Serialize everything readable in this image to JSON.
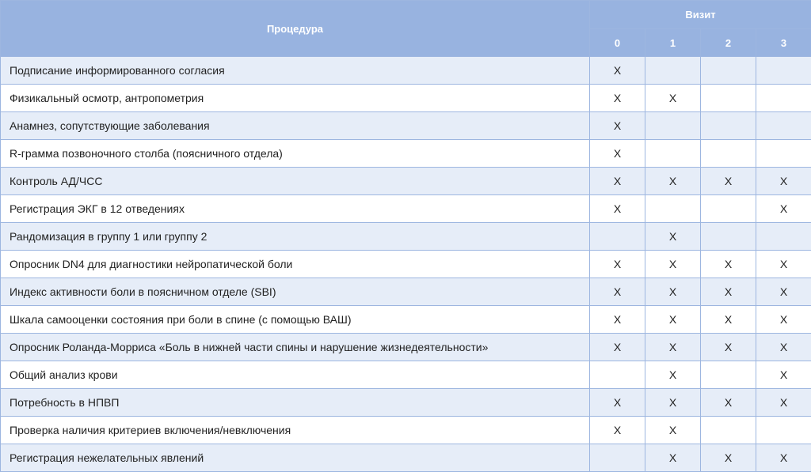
{
  "header": {
    "procedure_label": "Процедура",
    "visit_label": "Визит",
    "visits": [
      "0",
      "1",
      "2",
      "3"
    ]
  },
  "rows": [
    {
      "procedure": "Подписание информированного согласия",
      "marks": [
        "X",
        "",
        "",
        ""
      ]
    },
    {
      "procedure": "Физикальный осмотр, антропометрия",
      "marks": [
        "X",
        "X",
        "",
        ""
      ]
    },
    {
      "procedure": "Анамнез, сопутствующие заболевания",
      "marks": [
        "X",
        "",
        "",
        ""
      ]
    },
    {
      "procedure": "R-грамма позвоночного столба (поясничного отдела)",
      "marks": [
        "X",
        "",
        "",
        ""
      ]
    },
    {
      "procedure": "Контроль АД/ЧСС",
      "marks": [
        "X",
        "X",
        "X",
        "X"
      ]
    },
    {
      "procedure": "Регистрация ЭКГ в 12 отведениях",
      "marks": [
        "X",
        "",
        "",
        "X"
      ]
    },
    {
      "procedure": "Рандомизация в группу 1 или группу 2",
      "marks": [
        "",
        "X",
        "",
        ""
      ]
    },
    {
      "procedure": "Опросник DN4 для диагностики нейропатической боли",
      "marks": [
        "X",
        "X",
        "X",
        "X"
      ]
    },
    {
      "procedure": "Индекс активности боли в поясничном отделе (SBI)",
      "marks": [
        "X",
        "X",
        "X",
        "X"
      ]
    },
    {
      "procedure": "Шкала самооценки состояния при боли в спине (с помощью ВАШ)",
      "marks": [
        "X",
        "X",
        "X",
        "X"
      ]
    },
    {
      "procedure": "Опросник Роланда-Морриса «Боль в нижней части спины и нарушение жизнедеятельности»",
      "marks": [
        "X",
        "X",
        "X",
        "X"
      ]
    },
    {
      "procedure": "Общий анализ крови",
      "marks": [
        "",
        "X",
        "",
        "X"
      ]
    },
    {
      "procedure": "Потребность в НПВП",
      "marks": [
        "X",
        "X",
        "X",
        "X"
      ]
    },
    {
      "procedure": "Проверка наличия критериев включения/невключения",
      "marks": [
        "X",
        "X",
        "",
        ""
      ]
    },
    {
      "procedure": "Регистрация нежелательных явлений",
      "marks": [
        "",
        "X",
        "X",
        "X"
      ]
    }
  ]
}
